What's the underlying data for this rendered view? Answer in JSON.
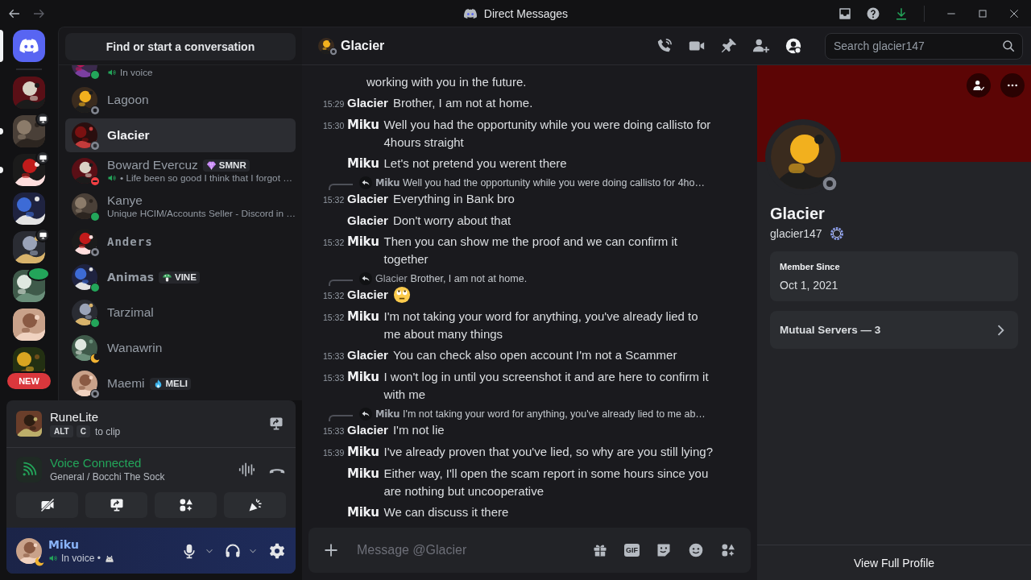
{
  "titlebar": {
    "title": "Direct Messages"
  },
  "servers": [
    {
      "unread": false,
      "streaming": false,
      "in_voice": false
    },
    {
      "unread": true,
      "streaming": true,
      "in_voice": false
    },
    {
      "unread": true,
      "streaming": true,
      "in_voice": false
    },
    {
      "unread": false,
      "streaming": false,
      "in_voice": false
    },
    {
      "unread": false,
      "streaming": true,
      "in_voice": false
    },
    {
      "unread": false,
      "streaming": false,
      "in_voice": true
    },
    {
      "unread": false,
      "streaming": false,
      "in_voice": false
    },
    {
      "unread": false,
      "streaming": false,
      "in_voice": false,
      "label": "NEW"
    }
  ],
  "dm_search": {
    "label": "Find or start a conversation"
  },
  "dms": [
    {
      "subtitle": "In voice",
      "in_voice": true,
      "color": "#23a55a",
      "selected": false
    },
    {
      "name": "Lagoon",
      "in_voice": false,
      "pixel_font": false,
      "display_font": false,
      "color": "#80848e",
      "selected": false
    },
    {
      "name": "Glacier",
      "in_voice": false,
      "pixel_font": false,
      "display_font": false,
      "color": "#80848e",
      "selected": true
    },
    {
      "name": "Boward Evercuz",
      "pixel_font": false,
      "display_font": false,
      "badge": {
        "kind": "gem",
        "label": "SMNR"
      },
      "subtitle": "• Life been so good I think that I forgot …",
      "in_voice": true,
      "color": "#f23f43",
      "selected": false
    },
    {
      "name": "Kanye",
      "pixel_font": false,
      "display_font": false,
      "subtitle": "Unique HCIM/Accounts Seller - Discord in …",
      "in_voice": false,
      "color": "#23a55a",
      "selected": false
    },
    {
      "name": "Anders",
      "pixel_font": true,
      "display_font": false,
      "in_voice": false,
      "color": "#80848e",
      "selected": false
    },
    {
      "name": "Animas",
      "pixel_font": false,
      "display_font": true,
      "badge": {
        "kind": "mushroom",
        "label": "VINE"
      },
      "in_voice": false,
      "color": "#23a55a",
      "selected": false
    },
    {
      "name": "Tarzimal",
      "pixel_font": false,
      "display_font": false,
      "in_voice": false,
      "color": "#23a55a",
      "selected": false
    },
    {
      "name": "Wanawrin",
      "pixel_font": false,
      "display_font": false,
      "in_voice": false,
      "color": "#f0b232",
      "selected": false
    },
    {
      "name": "Maemi",
      "pixel_font": false,
      "display_font": false,
      "badge": {
        "kind": "flame",
        "label": "MELI"
      },
      "in_voice": false,
      "color": "#80848e",
      "selected": false
    }
  ],
  "activity": {
    "title": "RuneLite",
    "keys": [
      "ALT",
      "C"
    ],
    "hint": "to clip"
  },
  "voice": {
    "status": "Voice Connected",
    "channel": "General / Bocchi The Sock",
    "buttons": [
      {
        "kind": "camera_off"
      },
      {
        "kind": "screen_share"
      },
      {
        "kind": "activities"
      },
      {
        "kind": "soundboard"
      }
    ]
  },
  "user": {
    "name": "Miku",
    "status_text": "In voice •",
    "color": "#f0b232"
  },
  "chat_header": {
    "name": "Glacier",
    "color": "#80848e",
    "profile_panel_open": true,
    "search_placeholder": "Search glacier147"
  },
  "messages": [
    {
      "kind": "fragment",
      "text": "working with you in the future."
    },
    {
      "kind": "text",
      "time": "15:29",
      "author": "Glacier",
      "custom_font": false,
      "text": "Brother, I am not at home."
    },
    {
      "kind": "text",
      "time": "15:30",
      "author": "Miku",
      "custom_font": true,
      "text": "Well you had the opportunity while you were doing callisto for 4hours straight"
    },
    {
      "kind": "text",
      "author": "Miku",
      "custom_font": true,
      "text": "Let's not pretend you werent there"
    },
    {
      "kind": "text",
      "time": "15:32",
      "author": "Glacier",
      "custom_font": false,
      "text": "Everything in Bank bro",
      "reply": {
        "author": "Miku",
        "custom_font": true,
        "text": "Well you had the opportunity while you were doing callisto for 4ho…"
      }
    },
    {
      "kind": "text",
      "author": "Glacier",
      "custom_font": false,
      "text": "Don't worry about that"
    },
    {
      "kind": "text",
      "time": "15:32",
      "author": "Miku",
      "custom_font": true,
      "text": "Then you can show me the proof and we can confirm it together"
    },
    {
      "kind": "emoji",
      "time": "15:32",
      "author": "Glacier",
      "custom_font": false,
      "reply": {
        "author": "Glacier",
        "custom_font": false,
        "text": "Brother, I am not at home."
      }
    },
    {
      "kind": "text",
      "time": "15:32",
      "author": "Miku",
      "custom_font": true,
      "text": "I'm not taking your word for anything, you've already lied to me about many things"
    },
    {
      "kind": "text",
      "time": "15:33",
      "author": "Glacier",
      "custom_font": false,
      "text": "You can check also open account I'm not a Scammer"
    },
    {
      "kind": "text",
      "time": "15:33",
      "author": "Miku",
      "custom_font": true,
      "text": "I won't log in until you screenshot it and are here to confirm it with me"
    },
    {
      "kind": "text",
      "time": "15:33",
      "author": "Glacier",
      "custom_font": false,
      "text": "I'm not lie",
      "reply": {
        "author": "Miku",
        "custom_font": true,
        "text": "I'm not taking your word for anything, you've already lied to me ab…"
      }
    },
    {
      "kind": "text",
      "time": "15:39",
      "author": "Miku",
      "custom_font": true,
      "text": "I've already proven that you've lied, so why are you still lying?"
    },
    {
      "kind": "text",
      "author": "Miku",
      "custom_font": true,
      "text": "Either way, I'll open the scam report in some hours since you are nothing but uncooperative"
    },
    {
      "kind": "text",
      "author": "Miku",
      "custom_font": true,
      "text": "We can discuss it there"
    }
  ],
  "composer": {
    "placeholder": "Message @Glacier",
    "gif_label": "GIF"
  },
  "profile": {
    "display_name": "Glacier",
    "username": "glacier147",
    "color": "#80848e",
    "member_since_label": "Member Since",
    "member_since": "Oct 1, 2021",
    "mutual_servers": "Mutual Servers — 3",
    "view_profile": "View Full Profile"
  }
}
